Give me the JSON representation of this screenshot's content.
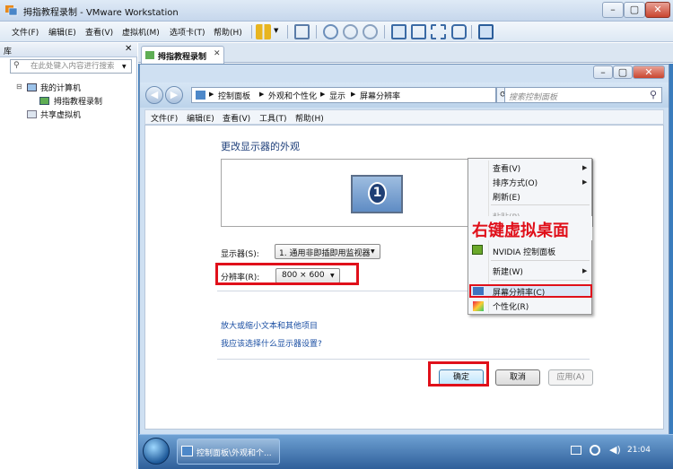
{
  "window": {
    "title": "拇指教程录制 - VMware Workstation"
  },
  "menubar": [
    "文件(F)",
    "编辑(E)",
    "查看(V)",
    "虚拟机(M)",
    "选项卡(T)",
    "帮助(H)"
  ],
  "library": {
    "title": "库",
    "search_placeholder": "在此处键入内容进行搜索",
    "my_computer": "我的计算机",
    "vm": "拇指教程录制",
    "shared": "共享虚拟机"
  },
  "vm_tab": {
    "label": "拇指教程录制"
  },
  "cp": {
    "breadcrumb": [
      "控制面板",
      "外观和个性化",
      "显示",
      "屏幕分辨率"
    ],
    "search_placeholder": "搜索控制面板",
    "menu": [
      "文件(F)",
      "编辑(E)",
      "查看(V)",
      "工具(T)",
      "帮助(H)"
    ],
    "heading": "更改显示器的外观",
    "monitor_number": "1",
    "display_label": "显示器(S):",
    "display_value": "1. 通用非即插即用监视器",
    "resolution_label": "分辨率(R):",
    "resolution_value": "800 × 600",
    "link1": "放大或缩小文本和其他项目",
    "link2": "我应该选择什么显示器设置?",
    "ok": "确定",
    "cancel": "取消",
    "apply": "应用(A)"
  },
  "context_menu": {
    "items": [
      "查看(V)",
      "排序方式(O)",
      "刷新(E)",
      "粘贴(P)",
      "NVIDIA 控制面板",
      "新建(W)",
      "屏幕分辨率(C)",
      "个性化(R)"
    ]
  },
  "annotation": "右键虚拟桌面",
  "taskbar": {
    "task": "控制面板\\外观和个...",
    "clock": "21:04"
  }
}
